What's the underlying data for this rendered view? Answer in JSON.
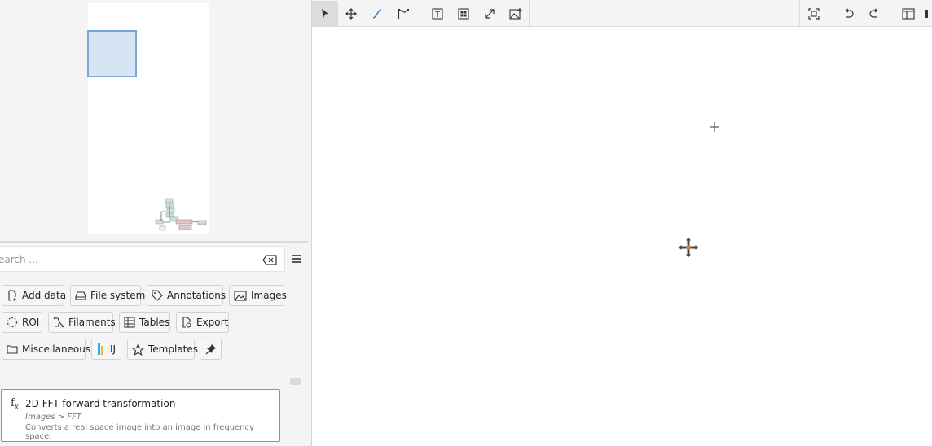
{
  "search": {
    "placeholder": "Search ...",
    "visible_text": "earch ..."
  },
  "categories": [
    {
      "label": "Add data",
      "icon": "file-plus-icon"
    },
    {
      "label": "File system",
      "icon": "drive-icon"
    },
    {
      "label": "Annotations",
      "icon": "tag-icon"
    },
    {
      "label": "Images",
      "icon": "image-icon"
    },
    {
      "label": "ROI",
      "icon": "roi-dotted-circle-icon"
    },
    {
      "label": "Filaments",
      "icon": "filament-icon"
    },
    {
      "label": "Tables",
      "icon": "table-icon"
    },
    {
      "label": "Export",
      "icon": "export-icon"
    },
    {
      "label": "Miscellaneous",
      "icon": "folder-icon"
    },
    {
      "label": "IJ",
      "icon": "imagej-icon"
    },
    {
      "label": "Templates",
      "icon": "star-icon"
    }
  ],
  "result": {
    "title": "2D FFT forward transformation",
    "path": "Images > FFT",
    "description": "Converts a real space image into an image in frequency space.",
    "icon": "function-icon"
  },
  "toolbar": {
    "tools": [
      "pointer-tool",
      "pan-tool",
      "connect-tool",
      "multi-connect-tool",
      "text-tool",
      "group-tool",
      "resize-tool",
      "add-image-tool"
    ],
    "right": [
      "fit-view",
      "undo",
      "redo",
      "layout-toggle"
    ]
  },
  "colors": {
    "accent_green": "#5fb35f",
    "navigator_viewport": "#7aa5d8",
    "cursor_orange": "#e07a20"
  }
}
